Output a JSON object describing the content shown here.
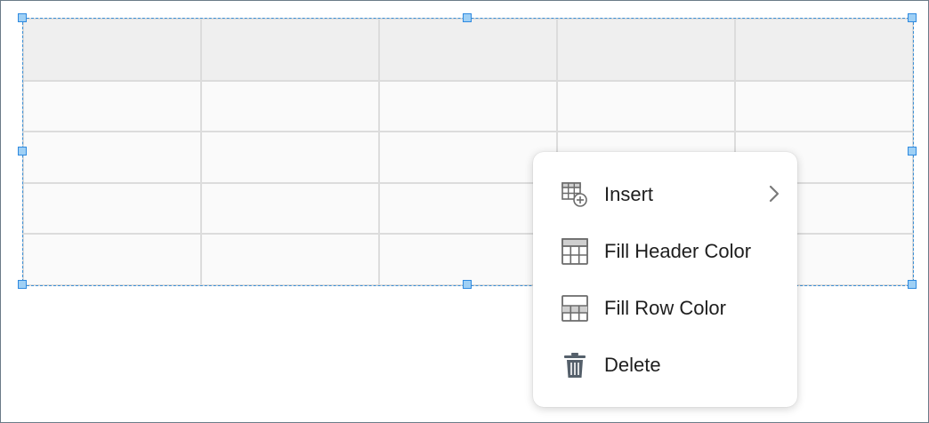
{
  "menu": {
    "items": [
      {
        "label": "Insert",
        "icon": "table-insert-icon",
        "has_submenu": true
      },
      {
        "label": "Fill Header Color",
        "icon": "table-header-fill-icon",
        "has_submenu": false
      },
      {
        "label": "Fill Row Color",
        "icon": "table-row-fill-icon",
        "has_submenu": false
      },
      {
        "label": "Delete",
        "icon": "trash-icon",
        "has_submenu": false
      }
    ]
  },
  "table": {
    "columns": 5,
    "rows": 5,
    "header_color": "#efefef",
    "cell_color": "#fafafa",
    "border_color": "#dcdcdc"
  },
  "selection": {
    "outline_color": "#3a8fd6",
    "handle_color": "#9fd0f5"
  }
}
